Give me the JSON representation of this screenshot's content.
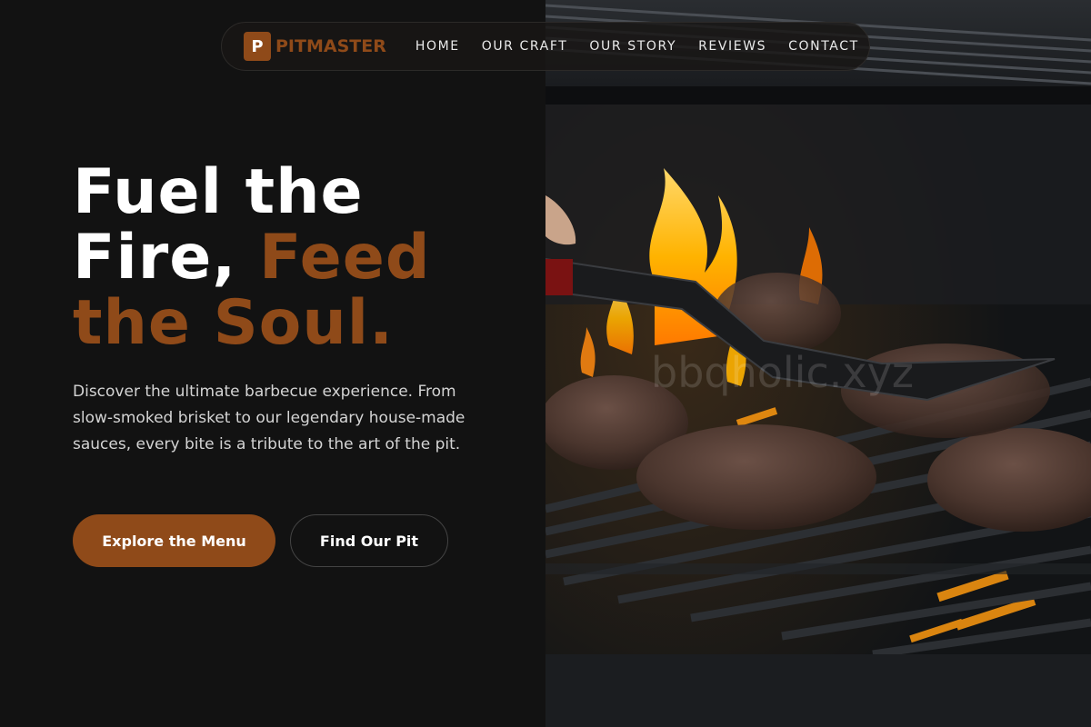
{
  "brand": {
    "mark": "P",
    "name": "PITMASTER",
    "accent_color": "#8f4a19"
  },
  "nav": {
    "links": [
      {
        "label": "HOME"
      },
      {
        "label": "OUR CRAFT"
      },
      {
        "label": "OUR STORY"
      },
      {
        "label": "REVIEWS"
      },
      {
        "label": "CONTACT"
      }
    ]
  },
  "hero": {
    "headline_line1": "Fuel the",
    "headline_line2_white": "Fire,",
    "headline_line2_accent": "Feed",
    "headline_line3_accent": "the Soul.",
    "description": "Discover the ultimate barbecue experience. From slow-smoked brisket to our legendary house-made sauces, every bite is a tribute to the art of the pit.",
    "primary_button": "Explore the Menu",
    "secondary_button": "Find Our Pit",
    "image_watermark": "bbqholic.xyz"
  }
}
